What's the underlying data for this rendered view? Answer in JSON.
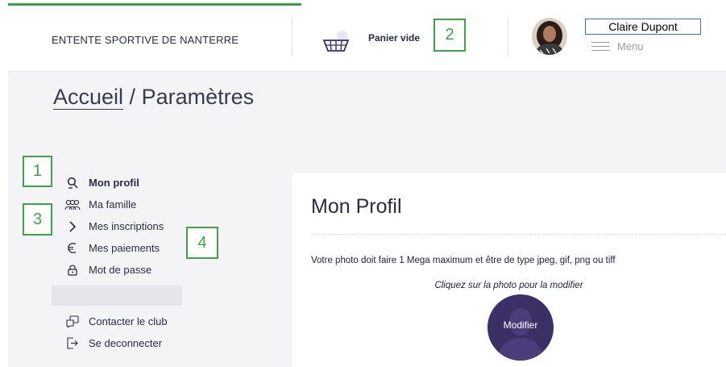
{
  "header": {
    "org_name": "ENTENTE SPORTIVE DE NANTERRE",
    "cart_label": "Panier vide",
    "user_name": "Claire Dupont",
    "menu_label": "Menu"
  },
  "breadcrumb": {
    "home": "Accueil",
    "separator": " / ",
    "current": "Paramètres"
  },
  "sidebar": {
    "items": [
      {
        "label": "Mon profil",
        "icon": "search-icon",
        "active": true
      },
      {
        "label": "Ma famille",
        "icon": "family-icon",
        "active": false
      },
      {
        "label": "Mes inscriptions",
        "icon": "chevron-right-icon",
        "active": false
      },
      {
        "label": "Mes paiements",
        "icon": "euro-icon",
        "active": false
      },
      {
        "label": "Mot de passe",
        "icon": "lock-icon",
        "active": false
      }
    ],
    "bottom_items": [
      {
        "label": "Contacter le club",
        "icon": "contact-icon"
      },
      {
        "label": "Se deconnecter",
        "icon": "logout-icon"
      }
    ]
  },
  "profile": {
    "title": "Mon Profil",
    "photo_requirements": "Votre photo doit faire 1 Mega maximum et être de type jpeg, gif, png ou tiff",
    "photo_hint": "Cliquez sur la photo pour la modifier",
    "photo_button": "Modifier"
  },
  "annotations": {
    "n1": "1",
    "n2": "2",
    "n3": "3",
    "n4": "4"
  },
  "colors": {
    "annotation_green": "#3da447",
    "photo_circle": "#3b2f66",
    "text_dark": "#2b2b45",
    "content_bg": "#f4f4f6"
  }
}
